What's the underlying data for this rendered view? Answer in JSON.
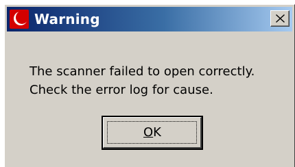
{
  "window": {
    "title": "Warning",
    "icon": "crescent-app-icon",
    "close_icon": "close-icon"
  },
  "message": {
    "line1": "The scanner failed to open correctly.",
    "line2": "Check the error log for cause."
  },
  "buttons": {
    "ok_mnemonic": "O",
    "ok_rest": "K"
  },
  "colors": {
    "titlebar_start": "#0a246a",
    "titlebar_end": "#a6caf0",
    "dialog_face": "#d4d0c8",
    "icon_red": "#d40000"
  }
}
